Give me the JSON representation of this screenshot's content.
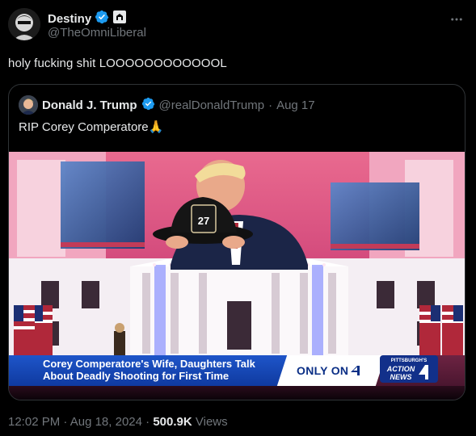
{
  "author": {
    "display_name": "Destiny",
    "handle": "@TheOmniLiberal"
  },
  "tweet": {
    "text": "holy fucking shit LOOOOOOOOOOOOL"
  },
  "quoted": {
    "display_name": "Donald J. Trump",
    "handle": "@realDonaldTrump",
    "separator": "·",
    "date": "Aug 17",
    "text": "RIP Corey Comperatore🙏",
    "media": {
      "helmet_number": "27",
      "banner_text_line1": "Corey Comperatore's Wife, Daughters Talk",
      "banner_text_line2": "About Deadly Shooting for First Time",
      "only_on_label": "ONLY ON",
      "channel_top": "PITTSBURGH'S",
      "channel_mid": "ACTION",
      "channel_bottom": "NEWS"
    }
  },
  "meta": {
    "time": "12:02 PM",
    "separator": "·",
    "date": "Aug 18, 2024",
    "views_count": "500.9K",
    "views_label": "Views"
  },
  "colors": {
    "background": "#000000",
    "text_primary": "#e7e9ea",
    "text_secondary": "#71767b",
    "verified": "#1d9bf0",
    "border": "#2f3336",
    "news_blue": "#1e55c9"
  },
  "icons": {
    "verified": "verified-badge-icon",
    "affiliate": "affiliate-badge-icon",
    "more": "more-horizontal-icon"
  }
}
